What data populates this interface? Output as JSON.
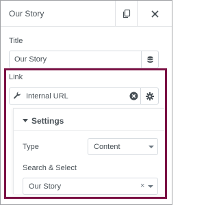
{
  "header": {
    "title": "Our Story"
  },
  "title_field": {
    "label": "Title",
    "value": "Our Story"
  },
  "link_field": {
    "label": "Link",
    "value": "Internal URL"
  },
  "settings": {
    "heading": "Settings",
    "type_label": "Type",
    "type_value": "Content",
    "search_label": "Search & Select",
    "search_value": "Our Story",
    "search_clear": "×"
  },
  "colors": {
    "highlight": "#7b1144",
    "border": "#d5dadf",
    "text": "#495157"
  }
}
